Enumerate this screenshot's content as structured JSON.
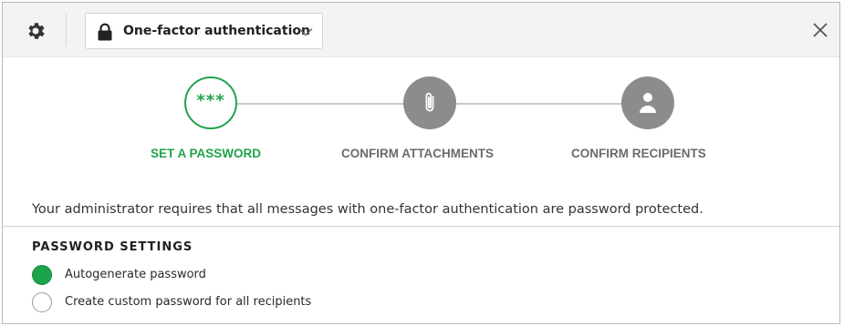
{
  "header": {
    "auth_mode": "One-factor authentication"
  },
  "steps": [
    {
      "label": "SET A PASSWORD",
      "icon": "password-dots-icon",
      "state": "active",
      "glyph": "***"
    },
    {
      "label": "CONFIRM ATTACHMENTS",
      "icon": "paperclip-icon",
      "state": "pending"
    },
    {
      "label": "CONFIRM RECIPIENTS",
      "icon": "person-icon",
      "state": "pending"
    }
  ],
  "notice": "Your administrator requires that all messages with one-factor authentication are password protected.",
  "password_settings": {
    "heading": "PASSWORD SETTINGS",
    "options": [
      {
        "label": "Autogenerate password",
        "selected": true
      },
      {
        "label": "Create custom password for all recipients",
        "selected": false
      }
    ]
  },
  "colors": {
    "active": "#21a34a",
    "inactive": "#8c8c8c",
    "header_bg": "#f3f3f3"
  }
}
